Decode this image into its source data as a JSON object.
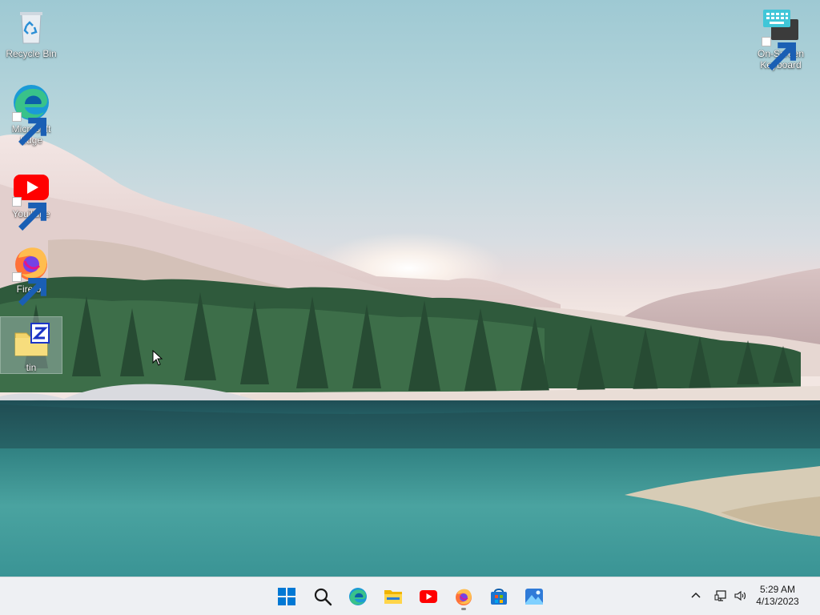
{
  "desktop": {
    "icons": [
      {
        "label": "Recycle Bin",
        "icon": "recycle-bin-icon",
        "shortcut": false
      },
      {
        "label": "Microsoft Edge",
        "icon": "edge-icon",
        "shortcut": true
      },
      {
        "label": "YouTube",
        "icon": "youtube-icon",
        "shortcut": true
      },
      {
        "label": "Firefox",
        "icon": "firefox-icon",
        "shortcut": true
      },
      {
        "label": "tin",
        "icon": "zip-folder-icon",
        "shortcut": false,
        "selected": true
      },
      {
        "label": "On-Screen Keyboard",
        "icon": "keyboard-icon",
        "shortcut": true
      }
    ]
  },
  "taskbar": {
    "apps": [
      {
        "name": "Start",
        "icon": "windows-start-icon"
      },
      {
        "name": "Search",
        "icon": "search-icon"
      },
      {
        "name": "Microsoft Edge",
        "icon": "edge-icon"
      },
      {
        "name": "File Explorer",
        "icon": "folder-icon"
      },
      {
        "name": "YouTube",
        "icon": "youtube-icon"
      },
      {
        "name": "Firefox",
        "icon": "firefox-icon",
        "running": true
      },
      {
        "name": "Microsoft Store",
        "icon": "store-icon"
      },
      {
        "name": "Photos",
        "icon": "photos-icon"
      }
    ],
    "tray": {
      "icons": [
        "chevron-up-icon",
        "network-icon",
        "volume-icon"
      ]
    },
    "clock": {
      "time": "5:29 AM",
      "date": "4/13/2023"
    }
  },
  "colors": {
    "taskbar_bg": "#eef0f3",
    "accent": "#0078d4"
  }
}
